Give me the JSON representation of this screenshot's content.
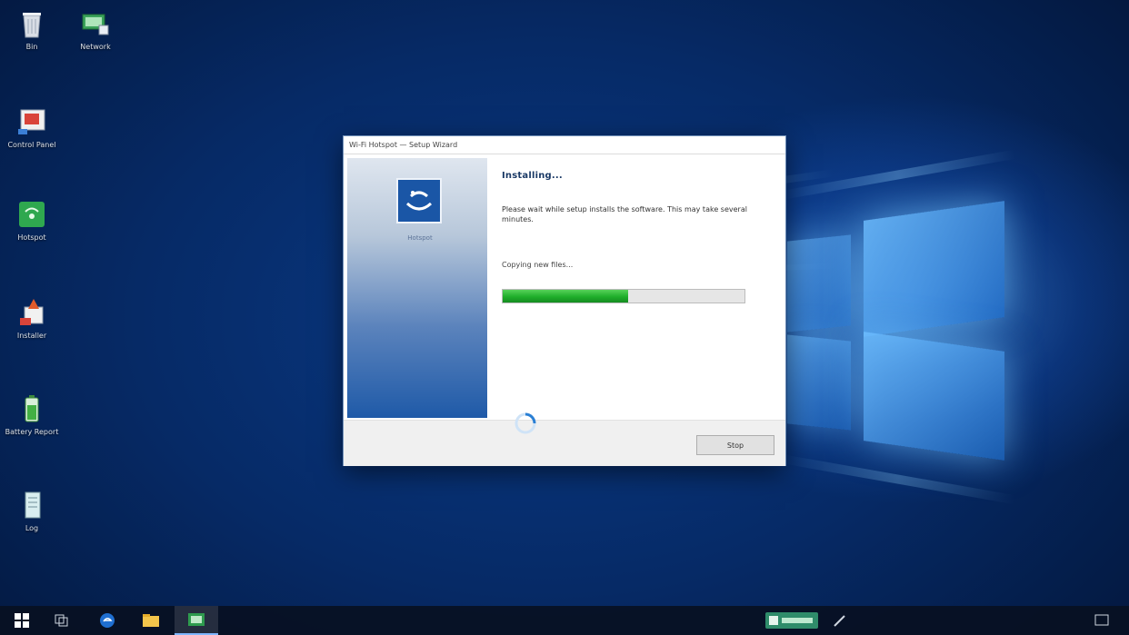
{
  "desktop": {
    "icons": [
      {
        "label": "Bin",
        "icon": "recycle-bin-icon"
      },
      {
        "label": "Network",
        "icon": "network-icon"
      },
      {
        "label": "Control Panel",
        "icon": "control-panel-icon"
      },
      {
        "label": "Hotspot",
        "icon": "hotspot-icon"
      },
      {
        "label": "Installer",
        "icon": "installer-icon"
      },
      {
        "label": "Battery Report",
        "icon": "battery-icon"
      },
      {
        "label": "Log",
        "icon": "log-file-icon"
      }
    ]
  },
  "installer": {
    "title": "Wi-Fi Hotspot — Setup Wizard",
    "side_caption": "Hotspot",
    "heading": "Installing...",
    "description": "Please wait while setup installs the software. This may take several minutes.",
    "status": "Copying new files...",
    "progress_fraction": 0.52,
    "stop_button_label": "Stop",
    "accent_color": "#1fae2a"
  },
  "taskbar": {
    "items": [
      {
        "icon": "start-icon"
      },
      {
        "icon": "task-view-icon"
      },
      {
        "icon": "edge-browser-icon"
      },
      {
        "icon": "file-explorer-icon"
      },
      {
        "icon": "installer-taskbar-icon",
        "active": true
      }
    ],
    "tray": [
      {
        "icon": "network-tray-icon"
      },
      {
        "icon": "pen-icon"
      },
      {
        "icon": "notifications-icon"
      }
    ]
  }
}
